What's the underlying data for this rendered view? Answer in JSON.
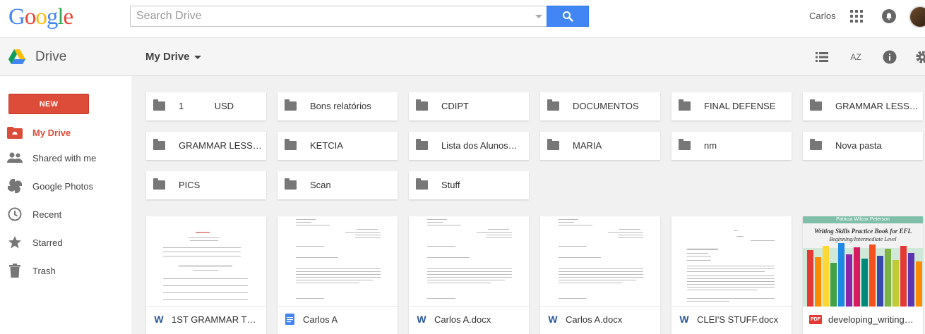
{
  "brand": {
    "logo_letters": [
      {
        "ch": "G",
        "color": "#4285f4"
      },
      {
        "ch": "o",
        "color": "#ea4335"
      },
      {
        "ch": "o",
        "color": "#fbbc05"
      },
      {
        "ch": "g",
        "color": "#4285f4"
      },
      {
        "ch": "l",
        "color": "#34a853"
      },
      {
        "ch": "e",
        "color": "#ea4335"
      }
    ],
    "app_title": "Drive"
  },
  "search": {
    "placeholder": "Search Drive",
    "value": ""
  },
  "account": {
    "name": "Carlos"
  },
  "breadcrumb": {
    "label": "My Drive"
  },
  "toolbar": {
    "icons": [
      "list-view-icon",
      "sort-az-icon",
      "info-icon",
      "settings-icon"
    ],
    "sort_label": "AZ"
  },
  "sidebar": {
    "new_label": "NEW",
    "items": [
      {
        "label": "My Drive",
        "icon": "my-drive-icon",
        "active": true
      },
      {
        "label": "Shared with me",
        "icon": "shared-icon",
        "active": false
      },
      {
        "label": "Google Photos",
        "icon": "photos-icon",
        "active": false
      },
      {
        "label": "Recent",
        "icon": "clock-icon",
        "active": false
      },
      {
        "label": "Starred",
        "icon": "star-icon",
        "active": false
      },
      {
        "label": "Trash",
        "icon": "trash-icon",
        "active": false
      }
    ]
  },
  "folders": [
    "1            USD",
    "Bons relatórios",
    "CDIPT",
    "DOCUMENTOS",
    "FINAL DEFENSE",
    "GRAMMAR LESS…",
    "GRAMMAR LESS…",
    "KETCIA",
    "Lista dos Alunos…",
    "MARIA",
    "nm",
    "Nova pasta",
    "PICS",
    "Scan",
    "Stuff"
  ],
  "files": [
    {
      "name": "1ST GRAMMAR TE…",
      "type": "word"
    },
    {
      "name": "Carlos A",
      "type": "gdoc"
    },
    {
      "name": "Carlos A.docx",
      "type": "word"
    },
    {
      "name": "Carlos A.docx",
      "type": "word"
    },
    {
      "name": "CLEI'S STUFF.docx",
      "type": "word"
    },
    {
      "name": "developing_writing.…",
      "type": "pdf"
    }
  ],
  "book_cover": {
    "author": "Patricia Wilcox Peterson",
    "title": "Writing Skills Practice Book for EFL",
    "subtitle": "Beginning/Intermediate Level"
  },
  "colors": {
    "accent_red": "#dd4b39",
    "search_blue": "#4285f4",
    "word_blue": "#2b579a",
    "gdoc_blue": "#4285f4",
    "pdf_red": "#e53935"
  }
}
